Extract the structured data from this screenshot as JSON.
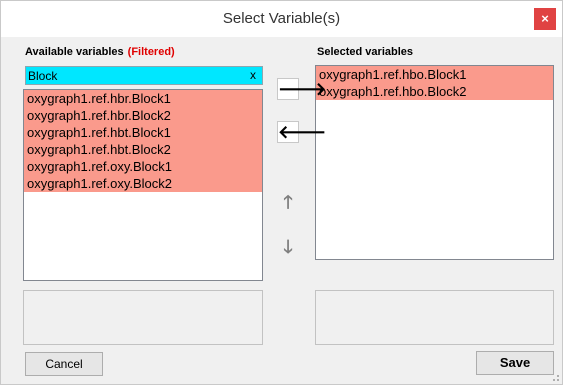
{
  "window": {
    "title": "Select Variable(s)",
    "close_label": "×"
  },
  "available": {
    "label": "Available variables",
    "filtered_label": "(Filtered)",
    "search_value": "Block",
    "clear_label": "x",
    "items": [
      "oxygraph1.ref.hbr.Block1",
      "oxygraph1.ref.hbr.Block2",
      "oxygraph1.ref.hbt.Block1",
      "oxygraph1.ref.hbt.Block2",
      "oxygraph1.ref.oxy.Block1",
      "oxygraph1.ref.oxy.Block2"
    ]
  },
  "selected": {
    "label": "Selected variables",
    "items": [
      "oxygraph1.ref.hbo.Block1",
      "oxygraph1.ref.hbo.Block2"
    ]
  },
  "arrows": {
    "add": "🡒",
    "remove": "🡐",
    "up": "🡑",
    "down": "🡓"
  },
  "buttons": {
    "cancel": "Cancel",
    "save": "Save"
  },
  "colors": {
    "highlight": "#fa9a8c",
    "search_bg": "#00e7ff",
    "close_bg": "#e04343",
    "filtered_text": "#e00000"
  }
}
